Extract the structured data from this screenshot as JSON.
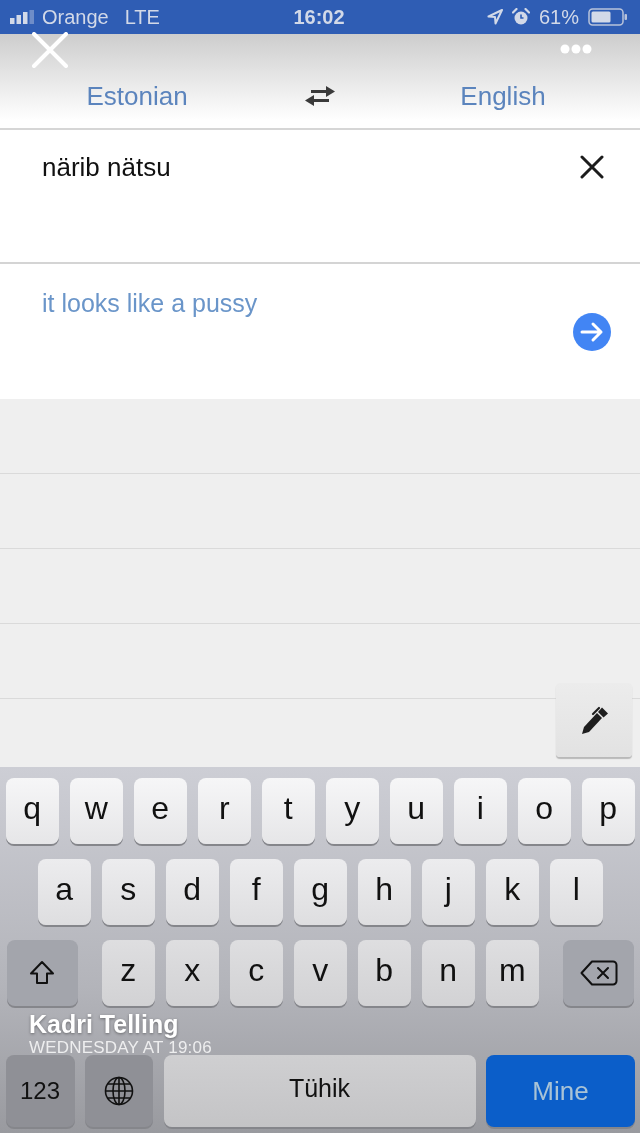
{
  "status_bar": {
    "carrier": "Orange",
    "network": "LTE",
    "time": "16:02",
    "battery": "61%"
  },
  "language_bar": {
    "source": "Estonian",
    "target": "English"
  },
  "input": {
    "value": "närib nätsu"
  },
  "translation": {
    "text": "it looks like a pussy"
  },
  "keyboard": {
    "rows": [
      {
        "keys": [
          {
            "kind": "letter",
            "label": "q"
          },
          {
            "kind": "letter",
            "label": "w"
          },
          {
            "kind": "letter",
            "label": "e"
          },
          {
            "kind": "letter",
            "label": "r"
          },
          {
            "kind": "letter",
            "label": "t"
          },
          {
            "kind": "letter",
            "label": "y"
          },
          {
            "kind": "letter",
            "label": "u"
          },
          {
            "kind": "letter",
            "label": "i"
          },
          {
            "kind": "letter",
            "label": "o"
          },
          {
            "kind": "letter",
            "label": "p"
          }
        ]
      },
      {
        "keys": [
          {
            "kind": "letter",
            "label": "a"
          },
          {
            "kind": "letter",
            "label": "s"
          },
          {
            "kind": "letter",
            "label": "d"
          },
          {
            "kind": "letter",
            "label": "f"
          },
          {
            "kind": "letter",
            "label": "g"
          },
          {
            "kind": "letter",
            "label": "h"
          },
          {
            "kind": "letter",
            "label": "j"
          },
          {
            "kind": "letter",
            "label": "k"
          },
          {
            "kind": "letter",
            "label": "l"
          }
        ]
      },
      {
        "keys": [
          {
            "kind": "shift"
          },
          {
            "kind": "letter",
            "label": "z"
          },
          {
            "kind": "letter",
            "label": "x"
          },
          {
            "kind": "letter",
            "label": "c"
          },
          {
            "kind": "letter",
            "label": "v"
          },
          {
            "kind": "letter",
            "label": "b"
          },
          {
            "kind": "letter",
            "label": "n"
          },
          {
            "kind": "letter",
            "label": "m"
          },
          {
            "kind": "backspace"
          }
        ]
      },
      {
        "keys": [
          {
            "kind": "numbers",
            "label": "123"
          },
          {
            "kind": "globe"
          },
          {
            "kind": "space",
            "label": "Tühik"
          },
          {
            "kind": "go",
            "label": "Mine"
          }
        ]
      }
    ]
  },
  "story": {
    "author": "Kadri Telling",
    "posted": "WEDNESDAY AT 19:06"
  }
}
